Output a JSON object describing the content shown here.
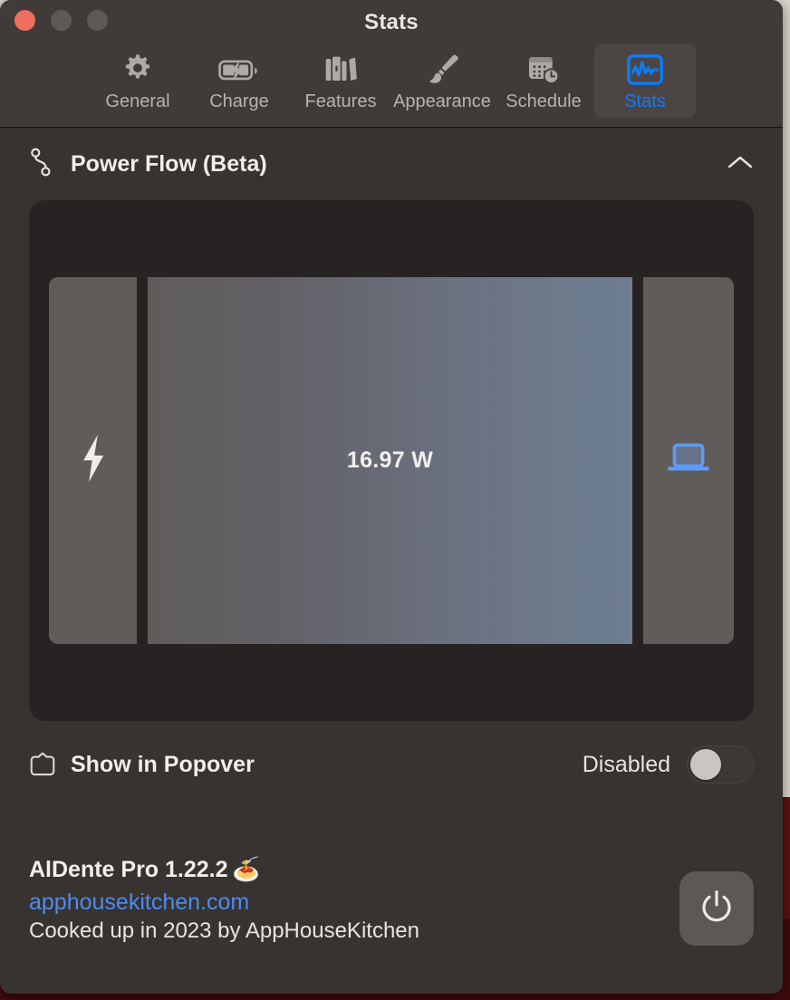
{
  "window": {
    "title": "Stats",
    "traffic_lights": [
      "close",
      "minimize",
      "zoom"
    ]
  },
  "toolbar": {
    "items": [
      {
        "label": "General",
        "icon": "gear-icon",
        "selected": false
      },
      {
        "label": "Charge",
        "icon": "battery-bolt-icon",
        "selected": false
      },
      {
        "label": "Features",
        "icon": "books-icon",
        "selected": false
      },
      {
        "label": "Appearance",
        "icon": "paintbrush-icon",
        "selected": false
      },
      {
        "label": "Schedule",
        "icon": "calendar-clock-icon",
        "selected": false
      },
      {
        "label": "Stats",
        "icon": "waveform-icon",
        "selected": true
      }
    ],
    "accent_color": "#0a7cff"
  },
  "power_flow": {
    "section_title": "Power Flow (Beta)",
    "section_icon": "flow-path-icon",
    "collapse_icon": "chevron-up-icon",
    "source_icon": "bolt-icon",
    "sink_icon": "laptop-icon",
    "value_label": "16.97 W"
  },
  "chart_data": {
    "type": "sankey",
    "title": "Power Flow (Beta)",
    "nodes": [
      {
        "id": "source",
        "label": "",
        "icon": "bolt-icon",
        "color": "#5f5c5a"
      },
      {
        "id": "sink",
        "label": "",
        "icon": "laptop-icon",
        "color": "#5f5c5a"
      }
    ],
    "links": [
      {
        "source": "source",
        "target": "sink",
        "value": 16.97,
        "unit": "W",
        "label": "16.97 W"
      }
    ],
    "gradient_from": "#5f5c5a",
    "gradient_to": "#6f7d91"
  },
  "popover_row": {
    "icon": "popover-icon",
    "label": "Show in Popover",
    "state_label": "Disabled",
    "enabled": false
  },
  "footer": {
    "app_name": "AlDente Pro 1.22.2",
    "app_emoji": "🍝",
    "website": "apphousekitchen.com",
    "credit": "Cooked up in 2023 by AppHouseKitchen",
    "quit_icon": "power-icon",
    "link_color": "#4d8bf0"
  }
}
